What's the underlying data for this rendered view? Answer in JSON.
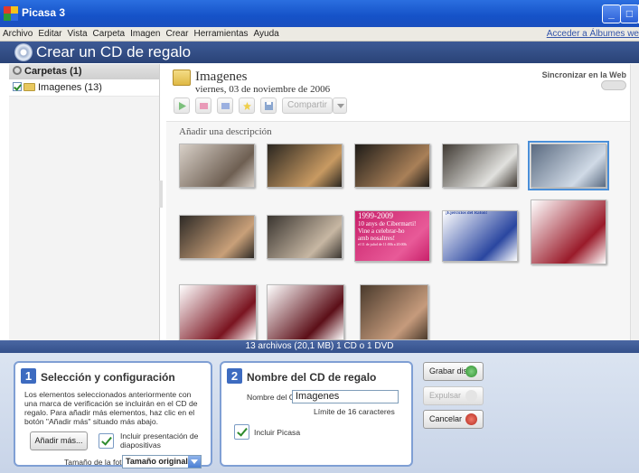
{
  "window": {
    "title": "Picasa 3",
    "controls": [
      "_",
      "□",
      "X"
    ]
  },
  "menu": {
    "items": [
      "Archivo",
      "Editar",
      "Vista",
      "Carpeta",
      "Imagen",
      "Crear",
      "Herramientas",
      "Ayuda"
    ],
    "albums_link": "Acceder a Álbumes we"
  },
  "header": {
    "title": "Crear un CD de regalo"
  },
  "sidebar": {
    "heading": "Carpetas (1)",
    "items": [
      {
        "label": "Imagenes (13)",
        "checked": true
      }
    ]
  },
  "album": {
    "name": "Imagenes",
    "date": "viernes, 03 de noviembre de 2006",
    "sync_label": "Sincronizar en la Web",
    "share_label": "Compartir",
    "description_placeholder": "Añadir una descripción",
    "toolbar_icons": [
      "play-icon",
      "slideshow-icon",
      "collage-icon",
      "star-icon",
      "save-icon"
    ]
  },
  "thumbnails": [
    {
      "name": "photo-1",
      "colors": [
        "#d8d0c8",
        "#6e5f52"
      ]
    },
    {
      "name": "photo-2",
      "colors": [
        "#2a2620",
        "#c89a62"
      ]
    },
    {
      "name": "photo-3",
      "colors": [
        "#1f1c18",
        "#a98058"
      ]
    },
    {
      "name": "photo-4",
      "colors": [
        "#403a33",
        "#e1e1de"
      ]
    },
    {
      "name": "photo-5",
      "colors": [
        "#5a6a80",
        "#d0dae6"
      ]
    },
    {
      "name": "photo-6",
      "colors": [
        "#2e2a26",
        "#c9a079"
      ]
    },
    {
      "name": "photo-7",
      "colors": [
        "#3a3530",
        "#c7b7a3"
      ]
    },
    {
      "name": "poster-cibermarti",
      "colors": [
        "#c8206a",
        "#e85a98"
      ],
      "lines": [
        "1999-2009",
        "10 anys de Cibermarti!",
        "Vine a celebrar-ho",
        "amb nosaltres!",
        "el 11 de juliol de 11:00h a 20:00h"
      ]
    },
    {
      "name": "web-page-1",
      "colors": [
        "#ffffff",
        "#2a46a0"
      ],
      "lines": [
        "¡Ejercicios del Ratón!"
      ]
    },
    {
      "name": "web-page-2",
      "colors": [
        "#ffffff",
        "#9a1b2a"
      ]
    },
    {
      "name": "web-page-3",
      "colors": [
        "#ffffff",
        "#7a1420"
      ]
    },
    {
      "name": "web-page-4",
      "colors": [
        "#ffffff",
        "#5c0f18"
      ]
    },
    {
      "name": "photo-speaker",
      "colors": [
        "#4a3a2c",
        "#c69b7c"
      ]
    }
  ],
  "status": {
    "text": "13 archivos (20,1 MB) 1 CD o 1 DVD"
  },
  "step1": {
    "number": "1",
    "title": "Selección y configuración",
    "text": "Los elementos seleccionados anteriormente con una marca de verificación se incluirán en el CD de regalo. Para añadir más elementos, haz clic en el botón \"Añadir más\" situado más abajo.",
    "add_more_label": "Añadir más...",
    "slideshow_label": "Incluir presentación de diapositivas",
    "slideshow_checked": true,
    "photo_size_label": "Tamaño de la foto",
    "photo_size_value": "Tamaño original"
  },
  "step2": {
    "number": "2",
    "title": "Nombre del CD de regalo",
    "name_label": "Nombre del CD",
    "name_value": "Imagenes",
    "limit_text": "Límite de 16 caracteres",
    "picasa_label": "Incluir Picasa",
    "picasa_checked": true
  },
  "actions": {
    "burn_label": "Grabar disco",
    "eject_label": "Expulsar",
    "cancel_label": "Cancelar"
  },
  "colors": {
    "titlebar": "#1552c8",
    "header": "#2a4377",
    "status": "#3d5a96",
    "panel_border": "#7f9fd4",
    "accent": "#3d6bc0"
  }
}
